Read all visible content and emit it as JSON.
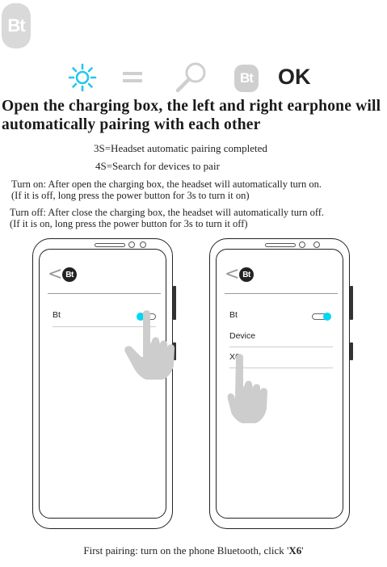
{
  "badge_top": "Bt",
  "icon_row": {
    "icons": [
      "sun-icon",
      "equals-icon",
      "search-icon",
      "bluetooth-icon"
    ],
    "bt_logo": "Bt",
    "ok": "OK",
    "colors": {
      "sun": "#22c7ef",
      "equals": "#cfcfcf",
      "search": "#cfcfcf",
      "bt": "#cfcfcf"
    }
  },
  "headline": "Open the charging box, the left and right earphone will automatically pairing with each other",
  "line_3s": "3S=Headset automatic pairing completed",
  "line_4s": "4S=Search for devices to pair",
  "turn_on": {
    "line1": "Turn on: After open the charging box, the headset will automatically turn on.",
    "line2": "(If it is off, long press the power button for 3s to turn it on)"
  },
  "turn_off": {
    "line1": "Turn off: After close the charging box, the headset will automatically turn off.",
    "line2": "(If it is on, long press the power button for 3s to turn it off)"
  },
  "phone_left": {
    "back": "<",
    "app_icon": "Bt",
    "rows": [
      "Bt"
    ],
    "toggle_state": "on"
  },
  "phone_right": {
    "back": "<",
    "app_icon": "Bt",
    "rows": [
      "Bt",
      "Device",
      "X6"
    ],
    "toggle_state": "on"
  },
  "accent_color": "#00d7f0",
  "footer": {
    "prefix": "First pairing: turn on the phone Bluetooth, click '",
    "highlight": "X6",
    "suffix": "'"
  }
}
